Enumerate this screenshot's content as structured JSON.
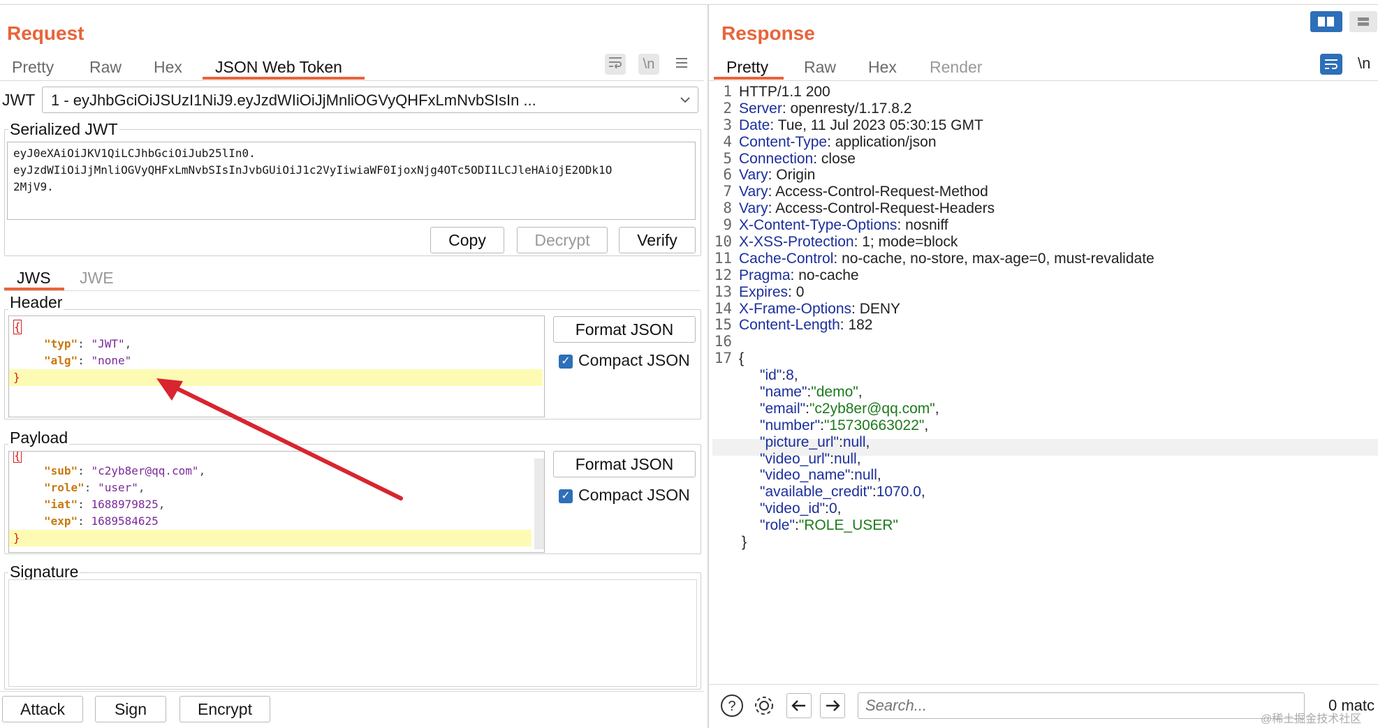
{
  "request": {
    "title": "Request",
    "tabs": [
      "Pretty",
      "Raw",
      "Hex",
      "JSON Web Token"
    ],
    "active_tab": "JSON Web Token",
    "icons": [
      "wrap-icon",
      "newline-icon",
      "menu-icon"
    ],
    "newline_label": "\\n",
    "jwt_label": "JWT",
    "jwt_select_value": "1 - eyJhbGciOiJSUzI1NiJ9.eyJzdWIiOiJjMnliOGVyQHFxLmNvbSIsIn ...",
    "serialized_label": "Serialized JWT",
    "serialized_lines": [
      "eyJ0eXAiOiJKV1QiLCJhbGciOiJub25lIn0.",
      "eyJzdWIiOiJjMnliOGVyQHFxLmNvbSIsInJvbGUiOiJ1c2VyIiwiaWF0IjoxNjg4OTc5ODI1LCJleHAiOjE2ODk1O",
      "2MjV9."
    ],
    "buttons": {
      "copy": "Copy",
      "decrypt": "Decrypt",
      "verify": "Verify"
    },
    "subtabs": [
      "JWS",
      "JWE"
    ],
    "active_subtab": "JWS",
    "header_label": "Header",
    "header_json": {
      "typ": "\"JWT\"",
      "alg": "\"none\""
    },
    "payload_label": "Payload",
    "payload_json": {
      "sub": "\"c2yb8er@qq.com\"",
      "role": "\"user\"",
      "iat": "1688979825",
      "exp": "1689584625"
    },
    "format_json": "Format JSON",
    "compact_json": "Compact JSON",
    "signature_label": "Signature",
    "bottom_buttons": [
      "Attack",
      "Sign",
      "Encrypt"
    ]
  },
  "response": {
    "title": "Response",
    "tabs": [
      "Pretty",
      "Raw",
      "Hex",
      "Render"
    ],
    "active_tab": "Pretty",
    "newline_label": "\\n",
    "headers": [
      {
        "n": "1",
        "name": "HTTP/1.1",
        "value": " 200"
      },
      {
        "n": "2",
        "name": "Server",
        "value": "openresty/1.17.8.2"
      },
      {
        "n": "3",
        "name": "Date",
        "value": "Tue, 11 Jul 2023 05:30:15 GMT"
      },
      {
        "n": "4",
        "name": "Content-Type",
        "value": "application/json"
      },
      {
        "n": "5",
        "name": "Connection",
        "value": "close"
      },
      {
        "n": "6",
        "name": "Vary",
        "value": "Origin"
      },
      {
        "n": "7",
        "name": "Vary",
        "value": "Access-Control-Request-Method"
      },
      {
        "n": "8",
        "name": "Vary",
        "value": "Access-Control-Request-Headers"
      },
      {
        "n": "9",
        "name": "X-Content-Type-Options",
        "value": "nosniff"
      },
      {
        "n": "10",
        "name": "X-XSS-Protection",
        "value": "1; mode=block"
      },
      {
        "n": "11",
        "name": "Cache-Control",
        "value": "no-cache, no-store, max-age=0, must-revalidate"
      },
      {
        "n": "12",
        "name": "Pragma",
        "value": "no-cache"
      },
      {
        "n": "13",
        "name": "Expires",
        "value": "0"
      },
      {
        "n": "14",
        "name": "X-Frame-Options",
        "value": "DENY"
      },
      {
        "n": "15",
        "name": "Content-Length",
        "value": "182"
      },
      {
        "n": "16",
        "name": "",
        "value": ""
      },
      {
        "n": "17",
        "name": "",
        "value": "{"
      }
    ],
    "body": [
      {
        "k": "\"id\"",
        "v": "8",
        "t": "n"
      },
      {
        "k": "\"name\"",
        "v": "\"demo\"",
        "t": "s"
      },
      {
        "k": "\"email\"",
        "v": "\"c2yb8er@qq.com\"",
        "t": "s"
      },
      {
        "k": "\"number\"",
        "v": "\"15730663022\"",
        "t": "s"
      },
      {
        "k": "\"picture_url\"",
        "v": "null",
        "t": "n"
      },
      {
        "k": "\"video_url\"",
        "v": "null",
        "t": "n"
      },
      {
        "k": "\"video_name\"",
        "v": "null",
        "t": "n"
      },
      {
        "k": "\"available_credit\"",
        "v": "1070.0",
        "t": "n"
      },
      {
        "k": "\"video_id\"",
        "v": "0",
        "t": "n"
      },
      {
        "k": "\"role\"",
        "v": "\"ROLE_USER\"",
        "t": "s"
      }
    ],
    "close_brace": "}",
    "search_placeholder": "Search...",
    "matches": "0 matc",
    "watermark": "@稀土掘金技术社区"
  }
}
